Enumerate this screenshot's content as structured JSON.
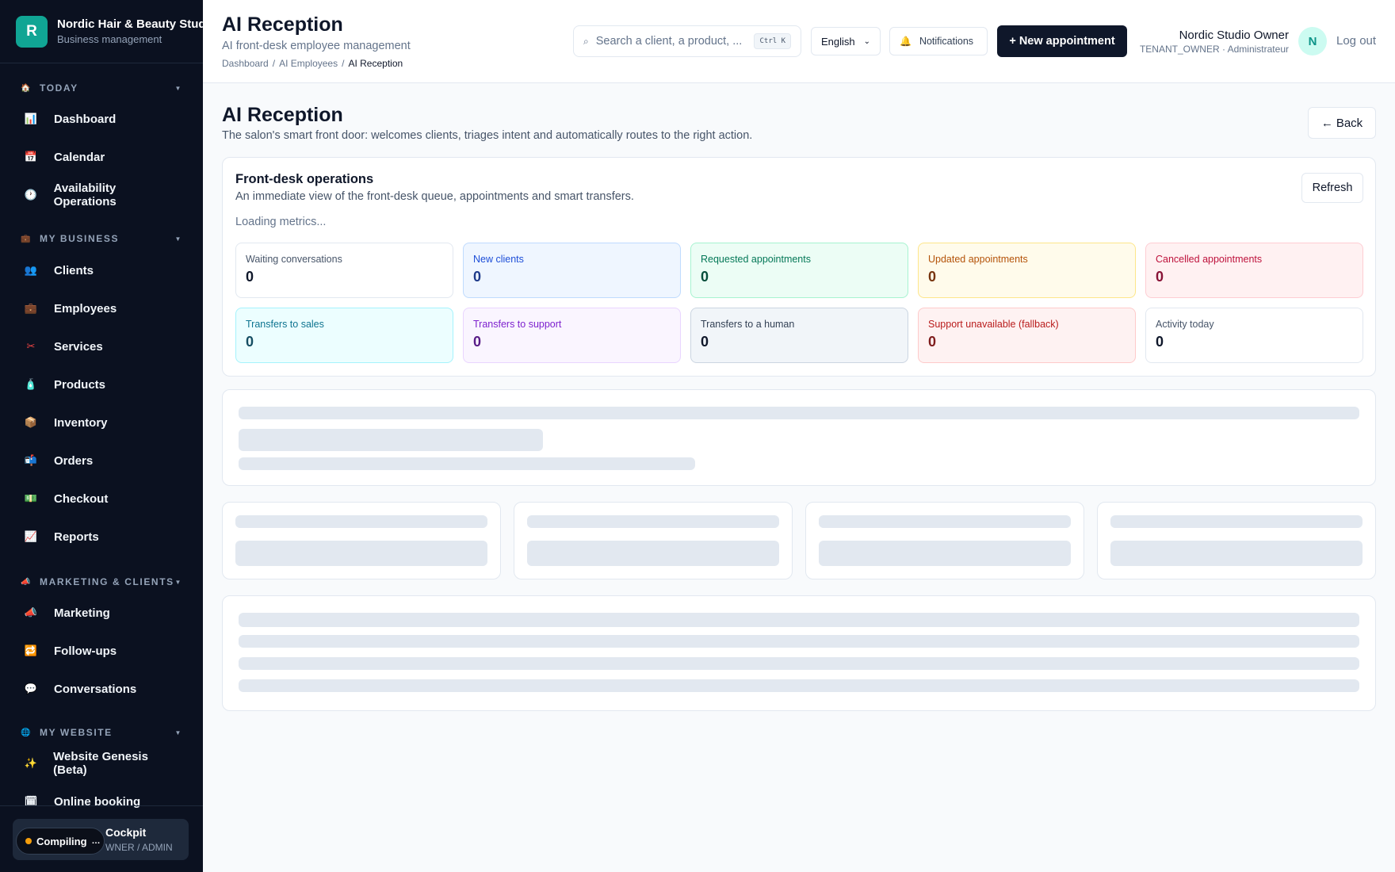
{
  "brand": {
    "logo_letter": "R",
    "name": "Nordic Hair & Beauty Studio",
    "subtitle": "Business management"
  },
  "sidebar": {
    "sections": [
      {
        "title": "TODAY",
        "icon": "home-icon",
        "items": [
          {
            "label": "Dashboard",
            "icon": "bar-chart-icon"
          },
          {
            "label": "Calendar",
            "icon": "calendar-icon"
          },
          {
            "label": "Availability Operations",
            "icon": "clock-icon"
          }
        ]
      },
      {
        "title": "MY BUSINESS",
        "icon": "briefcase-icon",
        "items": [
          {
            "label": "Clients",
            "icon": "users-icon"
          },
          {
            "label": "Employees",
            "icon": "briefcase-icon"
          },
          {
            "label": "Services",
            "icon": "scissors-icon"
          },
          {
            "label": "Products",
            "icon": "bottle-icon"
          },
          {
            "label": "Inventory",
            "icon": "box-icon"
          },
          {
            "label": "Orders",
            "icon": "mailbox-icon"
          },
          {
            "label": "Checkout",
            "icon": "cash-icon"
          },
          {
            "label": "Reports",
            "icon": "trend-chart-icon"
          }
        ]
      },
      {
        "title": "MARKETING & CLIENTS",
        "icon": "megaphone-icon",
        "items": [
          {
            "label": "Marketing",
            "icon": "megaphone-icon"
          },
          {
            "label": "Follow-ups",
            "icon": "repeat-icon"
          },
          {
            "label": "Conversations",
            "icon": "chat-bubble-icon"
          }
        ]
      },
      {
        "title": "MY WEBSITE",
        "icon": "globe-icon",
        "items": [
          {
            "label": "Website Genesis (Beta)",
            "icon": "sparkles-icon"
          },
          {
            "label": "Online booking",
            "icon": "booking-icon"
          }
        ]
      }
    ],
    "footer": {
      "title": "Cockpit",
      "subtitle": "WNER / ADMIN"
    },
    "compiling_badge": "Compiling"
  },
  "header": {
    "title": "AI Reception",
    "subtitle": "AI front-desk employee management",
    "breadcrumbs": [
      "Dashboard",
      "AI Employees",
      "AI Reception"
    ],
    "search_placeholder": "Search a client, a product, ...",
    "search_shortcut": "Ctrl K",
    "language": "English",
    "notifications_label": "Notifications",
    "new_appointment_label": "+ New appointment",
    "user_name": "Nordic Studio Owner",
    "user_role": "TENANT_OWNER · Administrateur",
    "avatar_letter": "N",
    "logout_label": "Log out"
  },
  "page": {
    "title": "AI Reception",
    "description": "The salon's smart front door: welcomes clients, triages intent and automatically routes to the right action.",
    "back_label": "Back"
  },
  "operations": {
    "title": "Front-desk operations",
    "description": "An immediate view of the front-desk queue, appointments and smart transfers.",
    "loading_text": "Loading metrics...",
    "refresh_label": "Refresh",
    "metrics": [
      {
        "label": "Waiting conversations",
        "value": "0",
        "bg": "#ffffff",
        "border": "#e2e8f0",
        "label_color": "#475569",
        "value_color": "#0f172a"
      },
      {
        "label": "New clients",
        "value": "0",
        "bg": "#eff6ff",
        "border": "#bfdbfe",
        "label_color": "#1d4ed8",
        "value_color": "#1e3a8a"
      },
      {
        "label": "Requested appointments",
        "value": "0",
        "bg": "#ecfdf5",
        "border": "#a7f3d0",
        "label_color": "#047857",
        "value_color": "#064e3b"
      },
      {
        "label": "Updated appointments",
        "value": "0",
        "bg": "#fffbeb",
        "border": "#fde68a",
        "label_color": "#b45309",
        "value_color": "#78350f"
      },
      {
        "label": "Cancelled appointments",
        "value": "0",
        "bg": "#fff1f2",
        "border": "#fecdd3",
        "label_color": "#be123c",
        "value_color": "#881337"
      },
      {
        "label": "Transfers to sales",
        "value": "0",
        "bg": "#ecfeff",
        "border": "#a5f3fc",
        "label_color": "#0e7490",
        "value_color": "#164e63"
      },
      {
        "label": "Transfers to support",
        "value": "0",
        "bg": "#faf5ff",
        "border": "#e9d5ff",
        "label_color": "#7e22ce",
        "value_color": "#581c87"
      },
      {
        "label": "Transfers to a human",
        "value": "0",
        "bg": "#f1f5f9",
        "border": "#cbd5e1",
        "label_color": "#334155",
        "value_color": "#0f172a"
      },
      {
        "label": "Support unavailable (fallback)",
        "value": "0",
        "bg": "#fef2f2",
        "border": "#fecaca",
        "label_color": "#b91c1c",
        "value_color": "#7f1d1d"
      },
      {
        "label": "Activity today",
        "value": "0",
        "bg": "#ffffff",
        "border": "#e2e8f0",
        "label_color": "#475569",
        "value_color": "#0f172a"
      }
    ]
  }
}
